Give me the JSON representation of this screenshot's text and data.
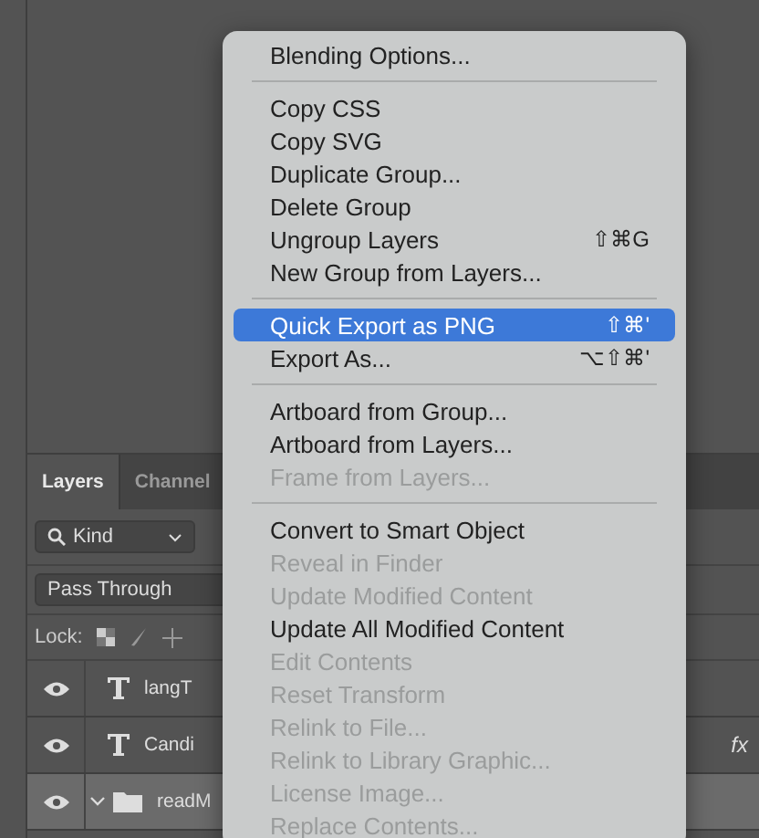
{
  "layers_panel": {
    "tabs": [
      {
        "label": "Layers",
        "selected": true
      },
      {
        "label": "Channel",
        "selected": false
      }
    ],
    "filter": {
      "value": "Kind"
    },
    "blend_mode": {
      "value": "Pass Through"
    },
    "lock_label": "Lock:",
    "layers": [
      {
        "name": "langT",
        "kind": "text",
        "visible": true,
        "selected": false
      },
      {
        "name": "Candi",
        "kind": "text",
        "visible": true,
        "selected": false,
        "effects": "fx"
      },
      {
        "name": "readM",
        "kind": "group",
        "visible": true,
        "selected": true,
        "expanded": true
      }
    ]
  },
  "context_menu": {
    "items": [
      {
        "kind": "item",
        "label": "Blending Options...",
        "disabled": false,
        "selected": false
      },
      {
        "kind": "separator"
      },
      {
        "kind": "item",
        "label": "Copy CSS",
        "disabled": false,
        "selected": false
      },
      {
        "kind": "item",
        "label": "Copy SVG",
        "disabled": false,
        "selected": false
      },
      {
        "kind": "item",
        "label": "Duplicate Group...",
        "disabled": false,
        "selected": false
      },
      {
        "kind": "item",
        "label": "Delete Group",
        "disabled": false,
        "selected": false
      },
      {
        "kind": "item",
        "label": "Ungroup Layers",
        "shortcut": "⇧⌘G",
        "disabled": false,
        "selected": false
      },
      {
        "kind": "item",
        "label": "New Group from Layers...",
        "disabled": false,
        "selected": false
      },
      {
        "kind": "separator"
      },
      {
        "kind": "item",
        "label": "Quick Export as PNG",
        "shortcut": "⇧⌘'",
        "disabled": false,
        "selected": true
      },
      {
        "kind": "item",
        "label": "Export As...",
        "shortcut": "⌥⇧⌘'",
        "disabled": false,
        "selected": false
      },
      {
        "kind": "separator"
      },
      {
        "kind": "item",
        "label": "Artboard from Group...",
        "disabled": false,
        "selected": false
      },
      {
        "kind": "item",
        "label": "Artboard from Layers...",
        "disabled": false,
        "selected": false
      },
      {
        "kind": "item",
        "label": "Frame from Layers...",
        "disabled": true,
        "selected": false
      },
      {
        "kind": "separator"
      },
      {
        "kind": "item",
        "label": "Convert to Smart Object",
        "disabled": false,
        "selected": false
      },
      {
        "kind": "item",
        "label": "Reveal in Finder",
        "disabled": true,
        "selected": false
      },
      {
        "kind": "item",
        "label": "Update Modified Content",
        "disabled": true,
        "selected": false
      },
      {
        "kind": "item",
        "label": "Update All Modified Content",
        "disabled": false,
        "selected": false
      },
      {
        "kind": "item",
        "label": "Edit Contents",
        "disabled": true,
        "selected": false
      },
      {
        "kind": "item",
        "label": "Reset Transform",
        "disabled": true,
        "selected": false
      },
      {
        "kind": "item",
        "label": "Relink to File...",
        "disabled": true,
        "selected": false
      },
      {
        "kind": "item",
        "label": "Relink to Library Graphic...",
        "disabled": true,
        "selected": false
      },
      {
        "kind": "item",
        "label": "License Image...",
        "disabled": true,
        "selected": false
      },
      {
        "kind": "item",
        "label": "Replace Contents...",
        "disabled": true,
        "selected": false
      }
    ]
  }
}
